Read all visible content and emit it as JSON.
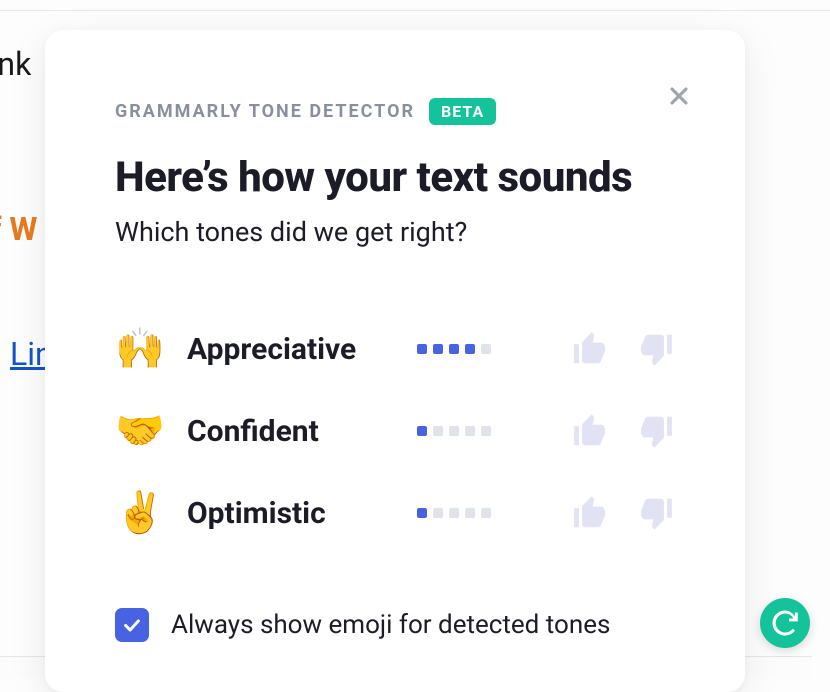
{
  "background": {
    "text1": "ank",
    "text2": "f W",
    "link": "Lin"
  },
  "modal": {
    "brand": "GRAMMARLY TONE DETECTOR",
    "badge": "BETA",
    "headline": "Here’s how your text sounds",
    "subhead": "Which tones did we get right?",
    "tones": [
      {
        "emoji": "🙌",
        "name": "Appreciative",
        "strength": 4
      },
      {
        "emoji": "🤝",
        "name": "Confident",
        "strength": 1
      },
      {
        "emoji": "✌️",
        "name": "Optimistic",
        "strength": 1
      }
    ],
    "checkbox": {
      "checked": true,
      "label": "Always show emoji for detected tones"
    }
  }
}
